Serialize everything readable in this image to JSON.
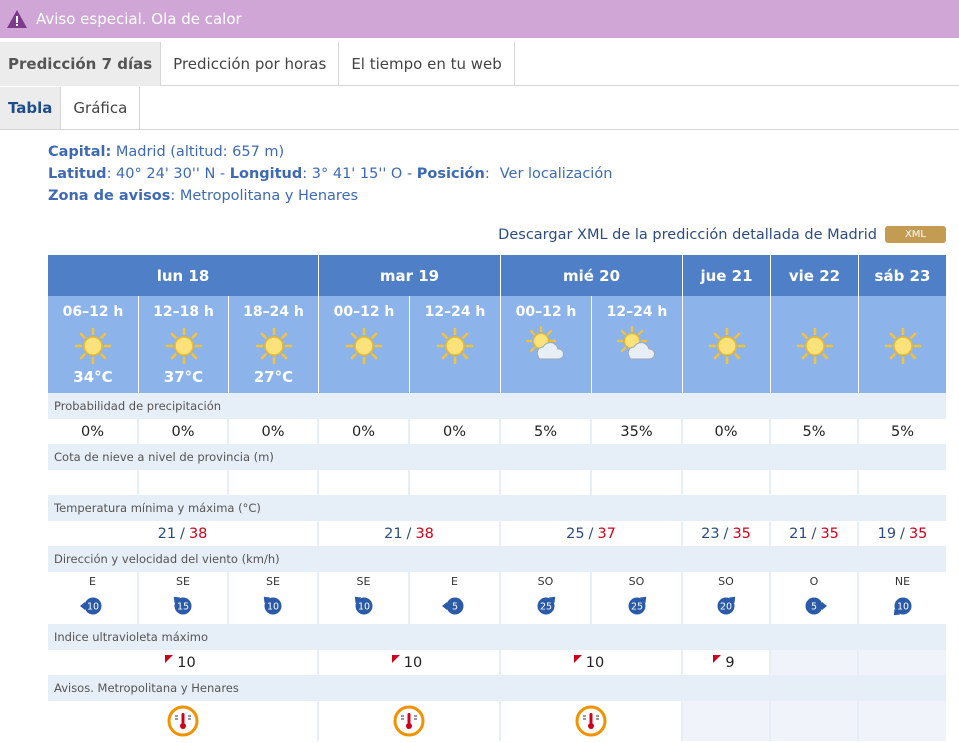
{
  "alert": {
    "text": "Aviso especial. Ola de calor"
  },
  "tabs": [
    "Predicción 7 días",
    "Predicción por horas",
    "El tiempo en tu web"
  ],
  "subtabs": [
    "Tabla",
    "Gráfica"
  ],
  "info": {
    "capital_label": "Capital:",
    "capital_value": "Madrid (altitud: 657 m)",
    "lat_label": "Latitud",
    "lat_value": ": 40° 24' 30'' N - ",
    "lon_label": "Longitud",
    "lon_value": ": 3° 41' 15'' O - ",
    "pos_label": "Posición",
    "pos_colon": ":",
    "pos_link": "Ver localización",
    "zone_label": "Zona de avisos",
    "zone_value": ": Metropolitana y Henares"
  },
  "xml": {
    "text": "Descargar XML de la predicción detallada de Madrid",
    "button": "XML"
  },
  "days": [
    "lun 18",
    "mar 19",
    "mié 20",
    "jue 21",
    "vie 22",
    "sáb 23"
  ],
  "periods": [
    {
      "label": "06–12 h",
      "icon": "sun-icon",
      "temp": "34°C"
    },
    {
      "label": "12–18 h",
      "icon": "sun-icon",
      "temp": "37°C"
    },
    {
      "label": "18–24 h",
      "icon": "sun-icon",
      "temp": "27°C"
    },
    {
      "label": "00–12 h",
      "icon": "sun-icon",
      "temp": ""
    },
    {
      "label": "12–24 h",
      "icon": "sun-icon",
      "temp": ""
    },
    {
      "label": "00–12 h",
      "icon": "sun-cloud-icon",
      "temp": ""
    },
    {
      "label": "12–24 h",
      "icon": "sun-cloud-icon",
      "temp": ""
    },
    {
      "label": "",
      "icon": "sun-icon",
      "temp": ""
    },
    {
      "label": "",
      "icon": "sun-icon",
      "temp": ""
    },
    {
      "label": "",
      "icon": "sun-icon",
      "temp": ""
    }
  ],
  "rows": {
    "precip_label": "Probabilidad de precipitación",
    "precip": [
      "0%",
      "0%",
      "0%",
      "0%",
      "0%",
      "5%",
      "35%",
      "0%",
      "5%",
      "5%"
    ],
    "snow_label": "Cota de nieve a nivel de provincia (m)",
    "temp_label": "Temperatura mínima y máxima (°C)",
    "temps": [
      {
        "min": "21",
        "max": "38"
      },
      {
        "min": "21",
        "max": "38"
      },
      {
        "min": "25",
        "max": "37"
      },
      {
        "min": "23",
        "max": "35"
      },
      {
        "min": "21",
        "max": "35"
      },
      {
        "min": "19",
        "max": "35"
      }
    ],
    "wind_label": "Dirección y velocidad del viento (km/h)",
    "wind": [
      {
        "dir": "E",
        "speed": "10"
      },
      {
        "dir": "SE",
        "speed": "15"
      },
      {
        "dir": "SE",
        "speed": "10"
      },
      {
        "dir": "SE",
        "speed": "10"
      },
      {
        "dir": "E",
        "speed": "5"
      },
      {
        "dir": "SO",
        "speed": "25"
      },
      {
        "dir": "SO",
        "speed": "25"
      },
      {
        "dir": "SO",
        "speed": "20"
      },
      {
        "dir": "O",
        "speed": "5"
      },
      {
        "dir": "NE",
        "speed": "10"
      }
    ],
    "uv_label": "Indice ultravioleta máximo",
    "uv": [
      "10",
      "10",
      "10",
      "9",
      "",
      ""
    ],
    "warn_label": "Avisos. Metropolitana y Henares",
    "warn": [
      true,
      true,
      true,
      false,
      false,
      false
    ]
  },
  "colors": {
    "alert_bg": "#cfa6d6",
    "day_header": "#4f7fc6",
    "period_bg": "#8db4ea",
    "label_bg": "#e6eef7",
    "tmax": "#d0021b",
    "tmin": "#2d4d80",
    "link": "#3e6ab5",
    "xml_button": "#c39b52",
    "warn_orange": "#f39200"
  }
}
